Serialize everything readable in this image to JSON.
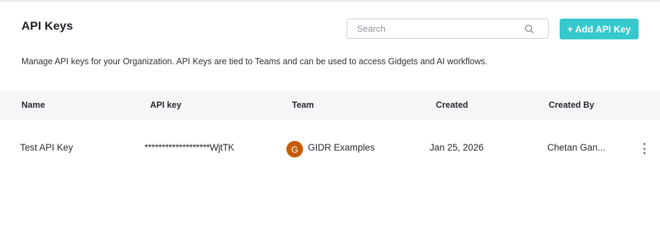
{
  "header": {
    "title": "API Keys",
    "search_placeholder": "Search",
    "add_button_label": "+ Add API Key",
    "description": "Manage API keys for your Organization. API Keys are tied to Teams and can be used to access Gidgets and AI workflows."
  },
  "table": {
    "columns": [
      "Name",
      "API key",
      "Team",
      "Created",
      "Created By"
    ],
    "rows": [
      {
        "name": "Test API Key",
        "api_key": "*******************WjtTK",
        "team_initial": "G",
        "team": "GIDR Examples",
        "created": "Jan 25, 2026",
        "created_by": "Chetan Gan..."
      }
    ]
  },
  "colors": {
    "accent": "#35c8cc",
    "team_avatar": "#c85b0a",
    "header_bg": "#f5f6f8"
  },
  "icons": {
    "search": "search-icon",
    "row_menu": "more-vertical-icon"
  }
}
